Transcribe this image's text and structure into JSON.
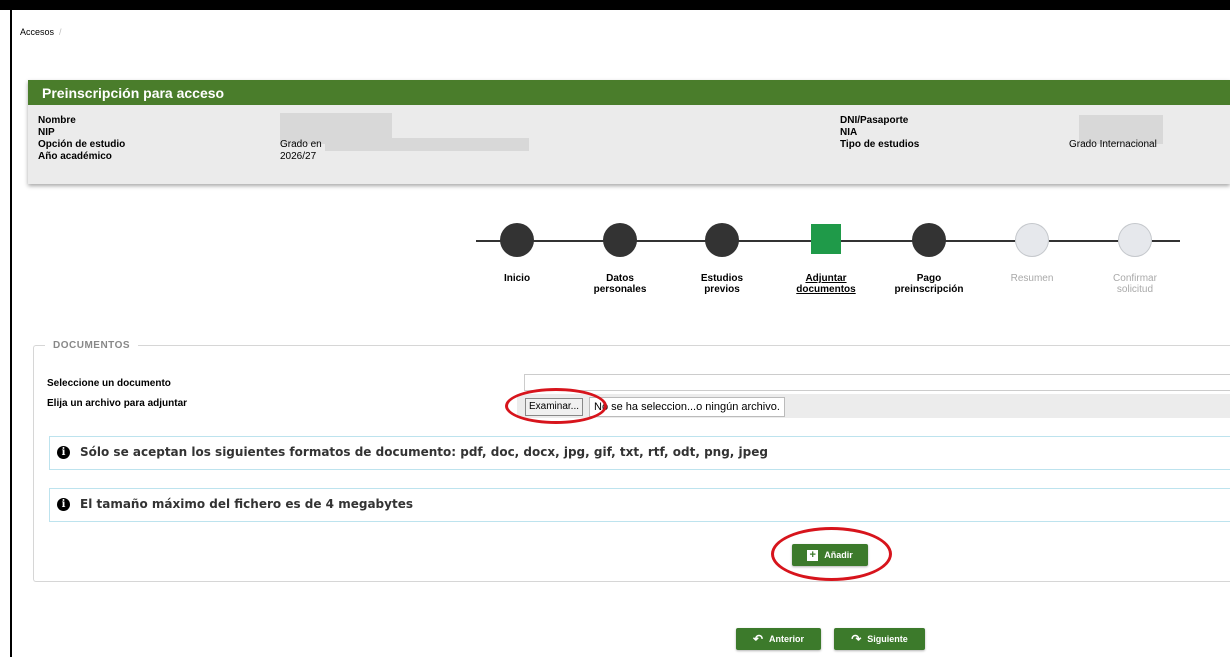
{
  "breadcrumb": {
    "item": "Accesos",
    "separator": "/"
  },
  "header": {
    "title": "Preinscripción para acceso",
    "labels": {
      "nombre": "Nombre",
      "nip": "NIP",
      "opcion": "Opción de estudio",
      "anio": "Año académico",
      "dni": "DNI/Pasaporte",
      "nia": "NIA",
      "tipo": "Tipo de estudios"
    },
    "values": {
      "opcion": "Grado en",
      "anio": "2026/27",
      "tipo": "Grado Internacional"
    }
  },
  "steps": [
    {
      "line1": "Inicio",
      "line2": ""
    },
    {
      "line1": "Datos",
      "line2": "personales"
    },
    {
      "line1": "Estudios",
      "line2": "previos"
    },
    {
      "line1": "Adjuntar",
      "line2": "documentos"
    },
    {
      "line1": "Pago",
      "line2": "preinscripción"
    },
    {
      "line1": "Resumen",
      "line2": ""
    },
    {
      "line1": "Confirmar",
      "line2": "solicitud"
    }
  ],
  "documents": {
    "legend": "DOCUMENTOS",
    "select_label": "Seleccione un documento",
    "file_label": "Elija un archivo para adjuntar",
    "browse_button": "Examinar...",
    "file_status": "No se ha seleccion...o ningún archivo.",
    "info_formats": "Sólo se aceptan los siguientes formatos de documento: pdf, doc, docx, jpg, gif, txt, rtf, odt, png, jpeg",
    "info_size": "El tamaño máximo del fichero es de 4 megabytes",
    "add_button": "Añadir"
  },
  "nav": {
    "previous": "Anterior",
    "next": "Siguiente"
  },
  "colors": {
    "brand_green": "#4a7d2b",
    "button_green": "#3c7a2b",
    "current_step": "#1f9a49",
    "highlight_red": "#d7141c"
  }
}
